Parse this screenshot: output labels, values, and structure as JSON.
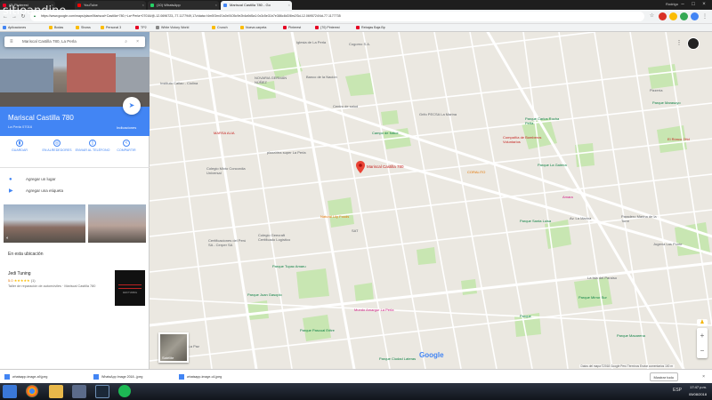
{
  "watermark": "sitioandino",
  "browser": {
    "tabs": [
      {
        "label": "(8) Pinterest",
        "color": "#e60023"
      },
      {
        "label": "YouTube",
        "color": "#ff0000"
      },
      {
        "label": "(10) WhatsApp",
        "color": "#25d366"
      },
      {
        "label": "Mariscal Castilla 780 - Go",
        "color": "#4285f4"
      }
    ],
    "user": "Rodrigo",
    "url": "https://www.google.com/maps/place/Mariscal+Castilla+780,+La+Perla+07016/@-12.0696723,-77.1177949,17z/data=!4m5!3m4!1s0x9105c9e2b4a9d5a1:0x3c5e31b7e386c8d3!8m2!3d-12.0695724!4d-77.1177735",
    "bookmarks": [
      {
        "label": "Aplicaciones",
        "color": "#4285f4"
      },
      {
        "label": "Bodas",
        "color": "#fbbc04"
      },
      {
        "label": "Shows",
        "color": "#fbbc04"
      },
      {
        "label": "Personal 3",
        "color": "#fbbc04"
      },
      {
        "label": "TP2",
        "color": "#e60023"
      },
      {
        "label": "White Victory World",
        "color": "#888888"
      },
      {
        "label": "Crunch",
        "color": "#fbbc04"
      },
      {
        "label": "Nueva carpeta",
        "color": "#fbbc04"
      },
      {
        "label": "Pinterest",
        "color": "#e60023"
      },
      {
        "label": "(70) Pinterest",
        "color": "#e60023"
      },
      {
        "label": "Rebajas Baja Bp",
        "color": "#e60023"
      }
    ]
  },
  "panel": {
    "search_value": "Mariscal Castilla 780, La Perla",
    "place_name": "Mariscal Castilla 780",
    "place_sub": "La Perla 07016",
    "directions_label": "Indicaciones",
    "actions": [
      {
        "label": "GUARDAR",
        "icon": "bookmark-icon",
        "glyph": "▮"
      },
      {
        "label": "EN ALREDEDORES",
        "icon": "nearby-icon",
        "glyph": "◎"
      },
      {
        "label": "ENVIAR AL TELÉFONO",
        "icon": "phone-icon",
        "glyph": "▯"
      },
      {
        "label": "COMPARTIR",
        "icon": "share-icon",
        "glyph": "<"
      }
    ],
    "add_place": "Agregar un lugar",
    "add_label": "Agregar una etiqueta",
    "area_title": "En esta ubicación",
    "business": {
      "name": "Jedi Tuning",
      "rating": "5.0",
      "stars": "★★★★★",
      "reviews": "(1)",
      "description": "Taller de reparación de automóviles · Mariscal Castilla 780",
      "thumb_text": "JEDI TUNING"
    }
  },
  "map": {
    "pin_label": "Mariscal Castilla 780",
    "satellite_label": "Satélite",
    "google": "Google",
    "attribution": "Datos del mapa ©2018 Google   Perú   Términos   Enviar comentarios   100 m",
    "labels": [
      {
        "text": "Instituto Callao - Ciolina",
        "cls": ""
      },
      {
        "text": "Iglesia de La Perla",
        "cls": ""
      },
      {
        "text": "Cogorno S.A.",
        "cls": ""
      },
      {
        "text": "NOVARIA GERMÁN NÚÑEZ",
        "cls": ""
      },
      {
        "text": "Banco de la Nación",
        "cls": ""
      },
      {
        "text": "Centro de salud",
        "cls": ""
      },
      {
        "text": "Grifo PECSA La Marina",
        "cls": ""
      },
      {
        "text": "Parque Carlos Rocha Peña",
        "cls": "green"
      },
      {
        "text": "MARSA ALIA",
        "cls": "red"
      },
      {
        "text": "Campo de fútbol",
        "cls": "green"
      },
      {
        "text": "Compañía de Bomberos Voluntarios",
        "cls": "red"
      },
      {
        "text": "plazaVea super La Perla",
        "cls": ""
      },
      {
        "text": "Colegio Mixto Concordia Universal",
        "cls": ""
      },
      {
        "text": "CORALITO",
        "cls": "orange"
      },
      {
        "text": "Parque La Galería",
        "cls": "green"
      },
      {
        "text": "Amara",
        "cls": "pink"
      },
      {
        "text": "Natural Lily Foods",
        "cls": "orange"
      },
      {
        "text": "Parque Santa Luisa",
        "cls": "green"
      },
      {
        "text": "Paradero Marina de la Torre",
        "cls": ""
      },
      {
        "text": "SAT",
        "cls": ""
      },
      {
        "text": "Colegio Geecraft Certificado Logístico",
        "cls": ""
      },
      {
        "text": "Certificaciones del Perú SA - Cerper SA",
        "cls": ""
      },
      {
        "text": "Parque Tupac Amaru",
        "cls": "green"
      },
      {
        "text": "La Isla del Paraíso",
        "cls": ""
      },
      {
        "text": "Parque Juan Gasoplo",
        "cls": "green"
      },
      {
        "text": "Parque Mirror Sur",
        "cls": "green"
      },
      {
        "text": "Mundo Amargur La Perla",
        "cls": "pink"
      },
      {
        "text": "Parque Pascual Eritre",
        "cls": "green"
      },
      {
        "text": "Parque",
        "cls": "green"
      },
      {
        "text": "Parque Macarena",
        "cls": "green"
      },
      {
        "text": "Pizzería",
        "cls": ""
      },
      {
        "text": "El Rónco 2Hd",
        "cls": "red"
      },
      {
        "text": "Parque Marasuyo",
        "cls": "green"
      },
      {
        "text": "Jugería Las Ponte",
        "cls": ""
      },
      {
        "text": "Parque Ciudad Lateras",
        "cls": "green"
      },
      {
        "text": "Av. La Paz",
        "cls": ""
      },
      {
        "text": "Av. La Marina",
        "cls": ""
      }
    ]
  },
  "downloads": {
    "items": [
      "whatsapp-image-a9.jpeg",
      "WhatsApp Image 2018...jpeg",
      "whatsapp-image-c4.jpeg"
    ],
    "show_all": "Mostrar todo"
  },
  "taskbar": {
    "time": "17:47 p.m.",
    "date": "05/08/2018",
    "lang": "ESP"
  }
}
